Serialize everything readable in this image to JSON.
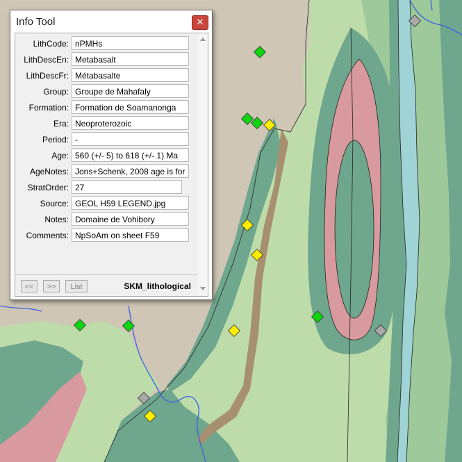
{
  "window": {
    "title": "Info Tool",
    "close_glyph": "✕"
  },
  "fields": [
    {
      "label": "LithCode:",
      "value": "nPMHs"
    },
    {
      "label": "LithDescEn:",
      "value": "Metabasalt"
    },
    {
      "label": "LithDescFr:",
      "value": "Métabasalte"
    },
    {
      "label": "Group:",
      "value": "Groupe de Mahafaly"
    },
    {
      "label": "Formation:",
      "value": "Formation de Soamanonga"
    },
    {
      "label": "Era:",
      "value": "Neoproterozoic"
    },
    {
      "label": "Period:",
      "value": "-"
    },
    {
      "label": "Age:",
      "value": "560 (+/- 5) to 618 (+/- 1) Ma"
    },
    {
      "label": "AgeNotes:",
      "value": "Jons+Schenk, 2008 age is for"
    },
    {
      "label": "StratOrder:",
      "value": "27"
    },
    {
      "label": "Source:",
      "value": "GEOL H59 LEGEND.jpg"
    },
    {
      "label": "Notes:",
      "value": "Domaine de Vohibory"
    },
    {
      "label": "Comments:",
      "value": "NpSoAm on sheet F59"
    }
  ],
  "footer": {
    "prev_label": "<<",
    "next_label": ">>",
    "list_label": "List",
    "layer_name": "SKM_lithological"
  },
  "map": {
    "icons": [
      "green-diamond-marker-icon",
      "yellow-diamond-marker-icon",
      "gray-diamond-marker-icon"
    ],
    "colors": {
      "terrain_tan": "#cfc6b5",
      "unit_light_green": "#bedcaa",
      "unit_green": "#9ec99a",
      "unit_dark_green": "#6ea78e",
      "unit_red": "#d89a9e",
      "unit_brown": "#a7906f",
      "unit_blue": "#9fd3d6",
      "river": "#3b5fe3",
      "marker_green": "#11d411",
      "marker_yellow": "#ffee00",
      "marker_gray": "#a9a9a9"
    }
  }
}
